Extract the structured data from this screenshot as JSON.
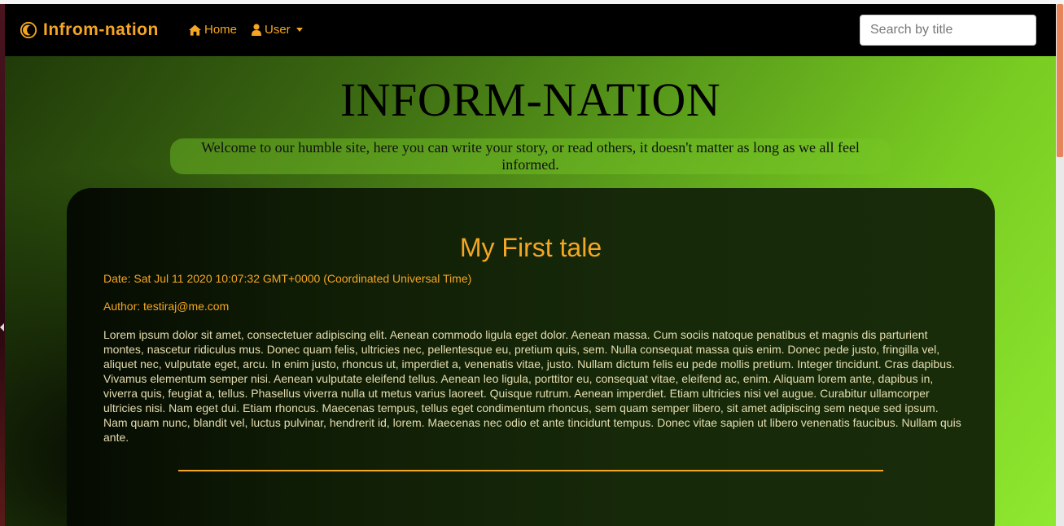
{
  "navbar": {
    "brand": "Infrom-nation",
    "home_label": "Home",
    "user_label": "User",
    "search_placeholder": "Search by title"
  },
  "hero": {
    "title": "INFORM-NATION",
    "tagline": "Welcome to our humble site, here you can write your story, or read others, it doesn't matter as long as we all feel informed."
  },
  "post": {
    "title": "My First tale",
    "date": "Date: Sat Jul 11 2020 10:07:32 GMT+0000 (Coordinated Universal Time)",
    "author": "Author: testiraj@me.com",
    "body": "Lorem ipsum dolor sit amet, consectetuer adipiscing elit. Aenean commodo ligula eget dolor. Aenean massa. Cum sociis natoque penatibus et magnis dis parturient montes, nascetur ridiculus mus. Donec quam felis, ultricies nec, pellentesque eu, pretium quis, sem. Nulla consequat massa quis enim. Donec pede justo, fringilla vel, aliquet nec, vulputate eget, arcu. In enim justo, rhoncus ut, imperdiet a, venenatis vitae, justo. Nullam dictum felis eu pede mollis pretium. Integer tincidunt. Cras dapibus. Vivamus elementum semper nisi. Aenean vulputate eleifend tellus. Aenean leo ligula, porttitor eu, consequat vitae, eleifend ac, enim. Aliquam lorem ante, dapibus in, viverra quis, feugiat a, tellus. Phasellus viverra nulla ut metus varius laoreet. Quisque rutrum. Aenean imperdiet. Etiam ultricies nisi vel augue. Curabitur ullamcorper ultricies nisi. Nam eget dui. Etiam rhoncus. Maecenas tempus, tellus eget condimentum rhoncus, sem quam semper libero, sit amet adipiscing sem neque sed ipsum. Nam quam nunc, blandit vel, luctus pulvinar, hendrerit id, lorem. Maecenas nec odio et ante tincidunt tempus. Donec vitae sapien ut libero venenatis faucibus. Nullam quis ante."
  },
  "icons": {
    "brand": "crescent-logo-icon",
    "home": "home-icon",
    "user": "user-icon",
    "dropdown": "caret-down-icon"
  },
  "colors": {
    "accent": "#f5a623",
    "navbar_bg": "#000000",
    "body_text": "#e6ddb0"
  }
}
